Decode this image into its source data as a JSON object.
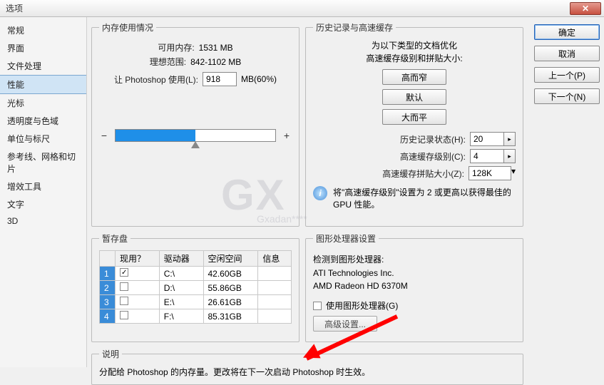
{
  "window": {
    "title": "选项"
  },
  "sidebar": {
    "items": [
      {
        "label": "常规"
      },
      {
        "label": "界面"
      },
      {
        "label": "文件处理"
      },
      {
        "label": "性能"
      },
      {
        "label": "光标"
      },
      {
        "label": "透明度与色域"
      },
      {
        "label": "单位与标尺"
      },
      {
        "label": "参考线、网格和切片"
      },
      {
        "label": "增效工具"
      },
      {
        "label": "文字"
      },
      {
        "label": "3D"
      }
    ],
    "selected_index": 3
  },
  "buttons": {
    "ok": "确定",
    "cancel": "取消",
    "prev": "上一个(P)",
    "next": "下一个(N)"
  },
  "memory": {
    "legend": "内存使用情况",
    "available_label": "可用内存:",
    "available_value": "1531 MB",
    "ideal_label": "理想范围:",
    "ideal_value": "842-1102 MB",
    "use_label": "让 Photoshop 使用(L):",
    "use_value": "918",
    "use_suffix": "MB(60%)",
    "minus": "−",
    "plus": "+"
  },
  "history": {
    "legend": "历史记录与高速缓存",
    "opt_line1": "为以下类型的文档优化",
    "opt_line2": "高速缓存级别和拼贴大小:",
    "btn_tall": "高而窄",
    "btn_default": "默认",
    "btn_big": "大而平",
    "states_label": "历史记录状态(H):",
    "states_value": "20",
    "levels_label": "高速缓存级别(C):",
    "levels_value": "4",
    "tile_label": "高速缓存拼贴大小(Z):",
    "tile_value": "128K",
    "info_text": "将\"高速缓存级别\"设置为 2 或更高以获得最佳的 GPU 性能。"
  },
  "scratch": {
    "legend": "暂存盘",
    "headers": {
      "active": "现用？",
      "drive": "驱动器",
      "free": "空闲空间",
      "info": "信息"
    },
    "rows": [
      {
        "idx": "1",
        "active": true,
        "drive": "C:\\",
        "free": "42.60GB",
        "info": ""
      },
      {
        "idx": "2",
        "active": false,
        "drive": "D:\\",
        "free": "55.86GB",
        "info": ""
      },
      {
        "idx": "3",
        "active": false,
        "drive": "E:\\",
        "free": "26.61GB",
        "info": ""
      },
      {
        "idx": "4",
        "active": false,
        "drive": "F:\\",
        "free": "85.31GB",
        "info": ""
      }
    ]
  },
  "gpu": {
    "legend": "图形处理器设置",
    "detected_label": "检测到图形处理器:",
    "vendor": "ATI Technologies Inc.",
    "model": "AMD Radeon HD 6370M",
    "use_label": "使用图形处理器(G)",
    "advanced": "高级设置..."
  },
  "description": {
    "legend": "说明",
    "text": "分配给 Photoshop 的内存量。更改将在下一次启动 Photoshop 时生效。"
  },
  "watermark": {
    "big": "GX",
    "small": "Gxadan****"
  }
}
